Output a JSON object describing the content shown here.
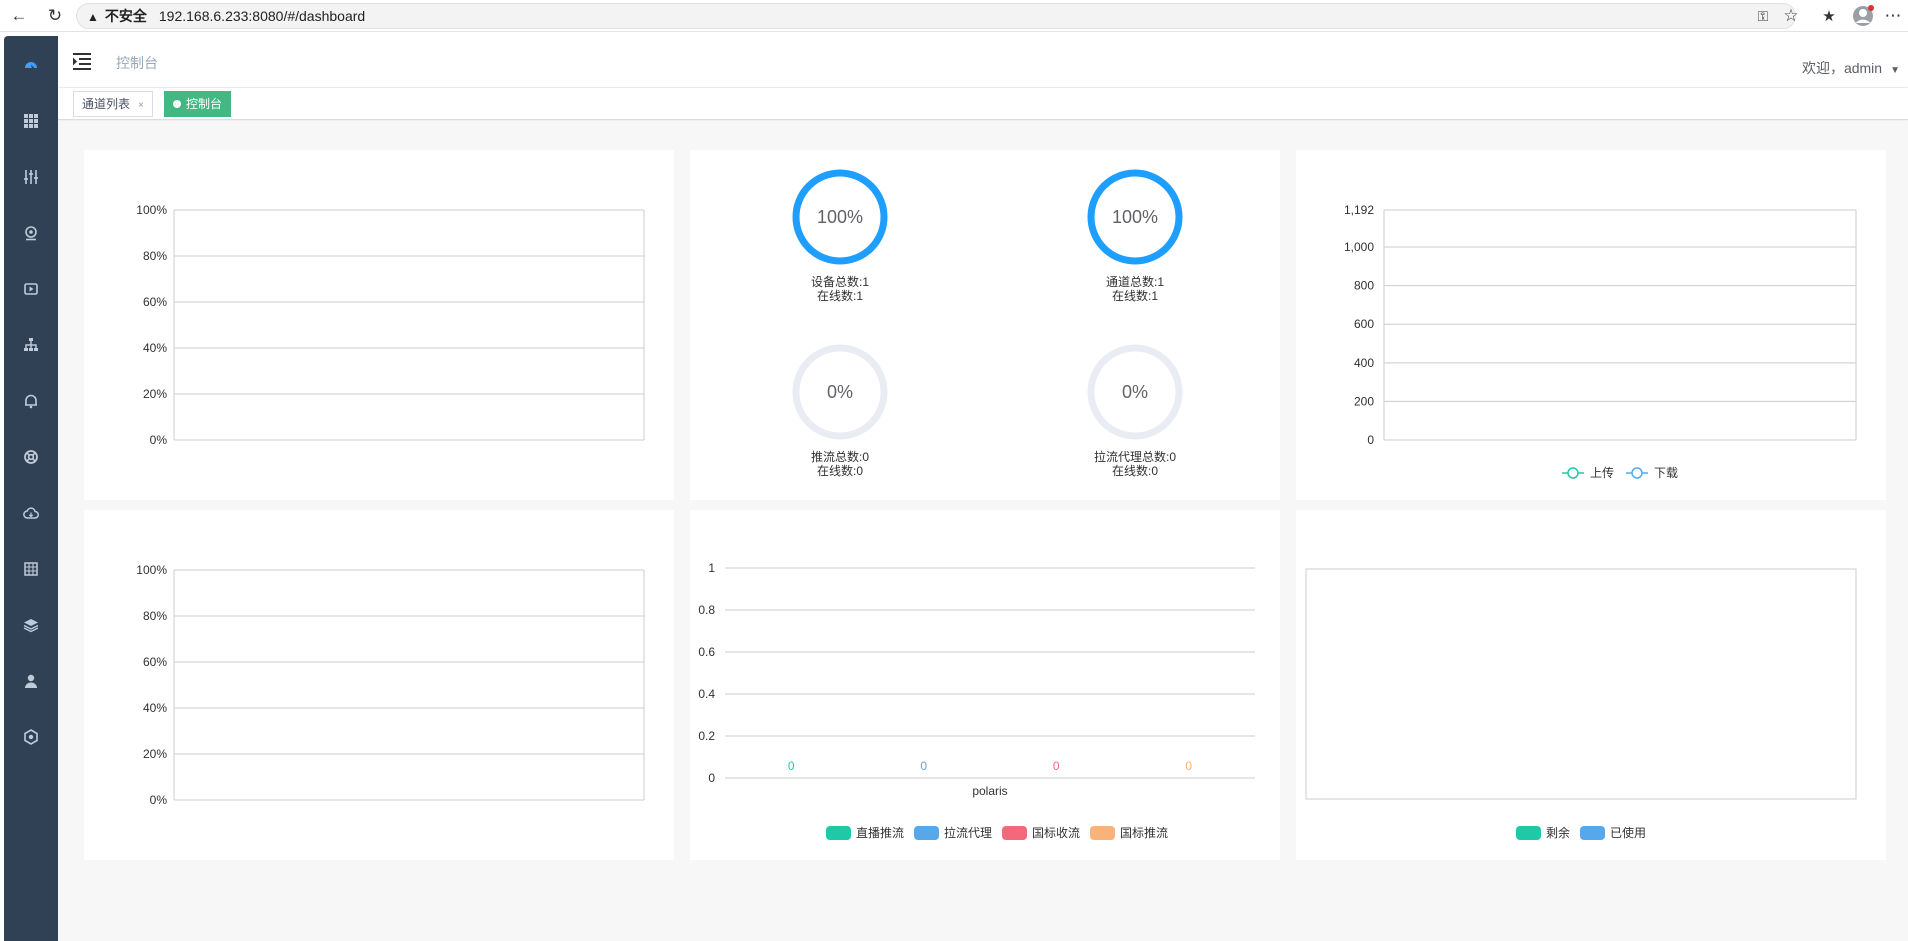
{
  "browser": {
    "insecure_label": "不安全",
    "url": "192.168.6.233:8080/#/dashboard"
  },
  "header": {
    "breadcrumb": "控制台",
    "welcome": "欢迎，admin"
  },
  "tags": [
    {
      "label": "通道列表",
      "active": false
    },
    {
      "label": "控制台",
      "active": true
    }
  ],
  "sidebar": {
    "icons": [
      "dashboard-icon",
      "grid-icon",
      "sliders-icon",
      "webcam-icon",
      "video-icon",
      "sitemap-icon",
      "bell-icon",
      "support-icon",
      "cloud-icon",
      "table-icon",
      "layers-icon",
      "user-icon",
      "settings-icon"
    ]
  },
  "colors": {
    "sidebar": "#304156",
    "tag_active": "#42b983",
    "gauge_on": "#1e9fff",
    "gauge_off": "#e9edf3",
    "green": "#20c9a6",
    "blue": "#57a8ea",
    "red": "#f4687e",
    "orange": "#fab27b"
  },
  "gauges": [
    {
      "percent_text": "100%",
      "value": 100,
      "line1": "设备总数:1",
      "line2": "在线数:1"
    },
    {
      "percent_text": "100%",
      "value": 100,
      "line1": "通道总数:1",
      "line2": "在线数:1"
    },
    {
      "percent_text": "0%",
      "value": 0,
      "line1": "推流总数:0",
      "line2": "在线数:0"
    },
    {
      "percent_text": "0%",
      "value": 0,
      "line1": "拉流代理总数:0",
      "line2": "在线数:0"
    }
  ],
  "chart_data": [
    {
      "type": "line",
      "title": "",
      "yticks": [
        "100%",
        "80%",
        "60%",
        "40%",
        "20%",
        "0%"
      ],
      "ylim": [
        0,
        100
      ],
      "series": [],
      "grid": true
    },
    {
      "type": "line",
      "title": "",
      "yticks": [
        "1,192",
        "1,000",
        "800",
        "600",
        "400",
        "200",
        "0"
      ],
      "ytick_values": [
        1192,
        1000,
        800,
        600,
        400,
        200,
        0
      ],
      "ylim": [
        0,
        1192
      ],
      "series": [
        {
          "name": "上传",
          "values": []
        },
        {
          "name": "下载",
          "values": []
        }
      ],
      "legend": "bottom",
      "grid": true
    },
    {
      "type": "line",
      "title": "",
      "yticks": [
        "100%",
        "80%",
        "60%",
        "40%",
        "20%",
        "0%"
      ],
      "ylim": [
        0,
        100
      ],
      "series": [],
      "grid": true
    },
    {
      "type": "bar",
      "title": "",
      "categories": [
        "polaris"
      ],
      "yticks": [
        "1",
        "0.8",
        "0.6",
        "0.4",
        "0.2",
        "0"
      ],
      "ylim": [
        0,
        1
      ],
      "series": [
        {
          "name": "直播推流",
          "values": [
            0
          ]
        },
        {
          "name": "拉流代理",
          "values": [
            0
          ]
        },
        {
          "name": "国标收流",
          "values": [
            0
          ]
        },
        {
          "name": "国标推流",
          "values": [
            0
          ]
        }
      ],
      "data_labels": [
        "0",
        "0",
        "0",
        "0"
      ],
      "legend": "bottom",
      "grid": true
    },
    {
      "type": "pie",
      "title": "",
      "series": [
        {
          "name": "剩余",
          "values": []
        },
        {
          "name": "已使用",
          "values": []
        }
      ],
      "legend": "bottom"
    }
  ]
}
